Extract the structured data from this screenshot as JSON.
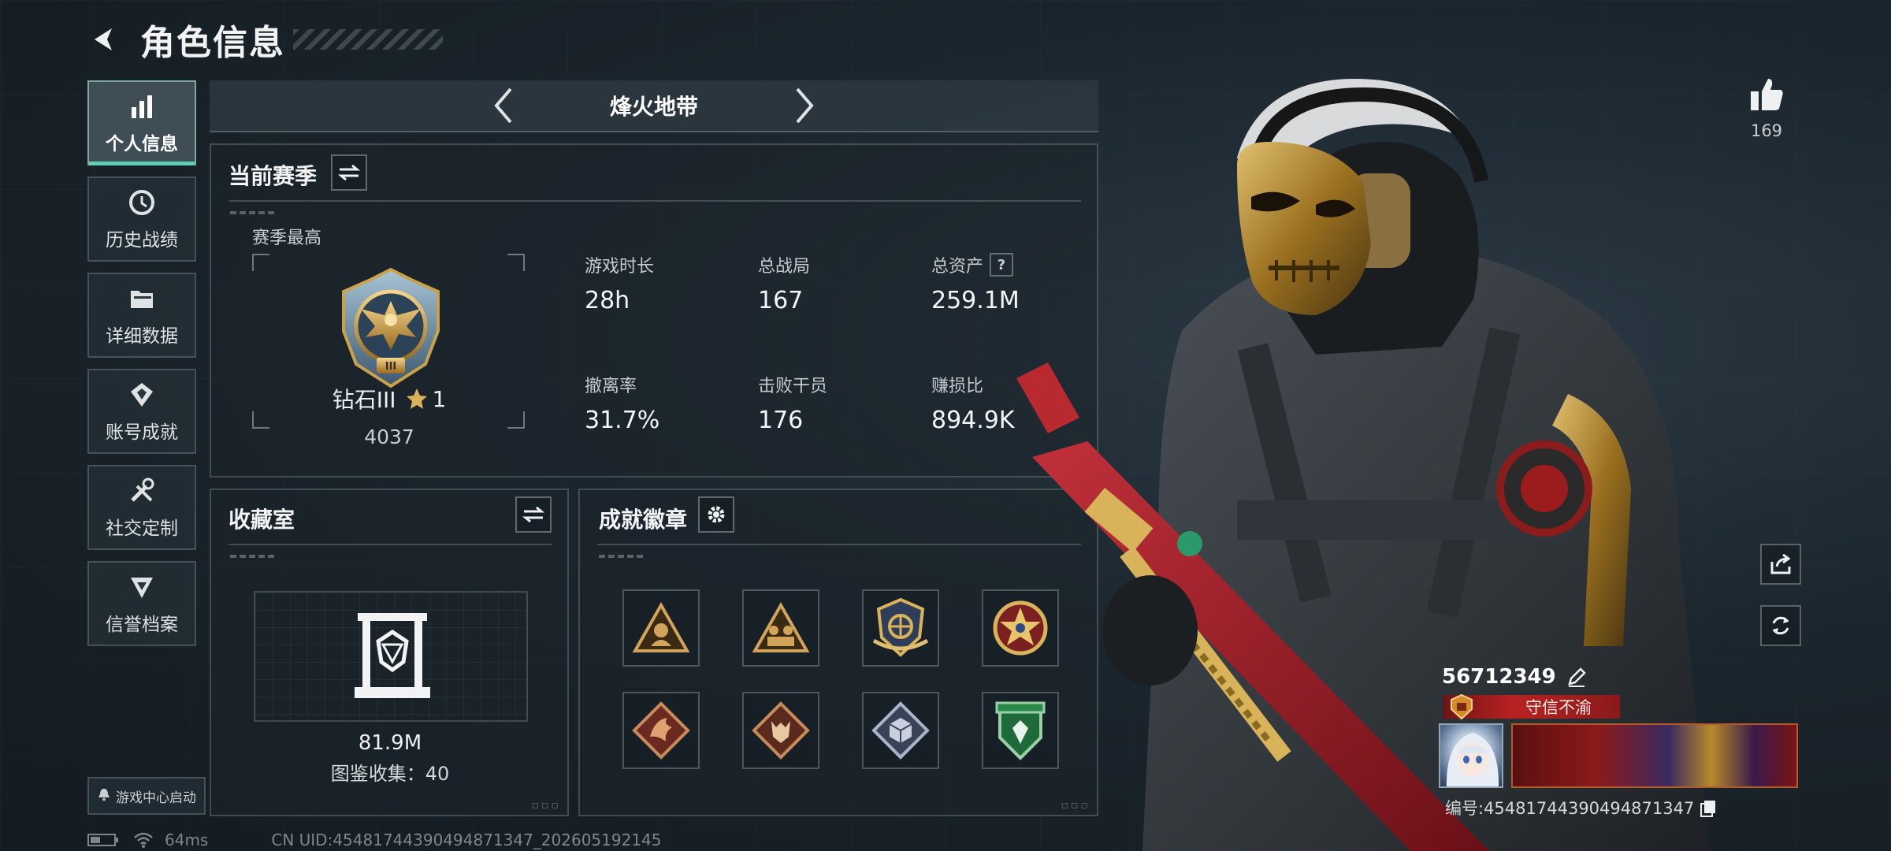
{
  "header": {
    "title": "角色信息"
  },
  "sidebar": {
    "items": [
      {
        "label": "个人信息",
        "icon": "bar-chart-icon",
        "active": true
      },
      {
        "label": "历史战绩",
        "icon": "history-icon"
      },
      {
        "label": "详细数据",
        "icon": "folder-icon"
      },
      {
        "label": "账号成就",
        "icon": "achievement-icon"
      },
      {
        "label": "社交定制",
        "icon": "tools-icon"
      },
      {
        "label": "信誉档案",
        "icon": "credit-icon"
      }
    ],
    "launch_label": "游戏中心启动"
  },
  "mode": {
    "name": "烽火地带"
  },
  "season": {
    "title": "当前赛季",
    "best_label": "赛季最高",
    "rank_name": "钻石III",
    "rank_stars": "1",
    "rank_score": "4037",
    "stats": [
      {
        "label": "游戏时长",
        "value": "28h"
      },
      {
        "label": "总战局",
        "value": "167"
      },
      {
        "label": "总资产",
        "value": "259.1M",
        "help": "?"
      },
      {
        "label": "撤离率",
        "value": "31.7%"
      },
      {
        "label": "击败干员",
        "value": "176"
      },
      {
        "label": "赚损比",
        "value": "894.9K"
      }
    ]
  },
  "collection": {
    "title": "收藏室",
    "value": "81.9M",
    "count_text": "图鉴收集：40"
  },
  "badges": {
    "title": "成就徽章",
    "items": [
      {
        "name": "badge-triangle-portrait"
      },
      {
        "name": "badge-triangle-soldiers"
      },
      {
        "name": "badge-shield-wings"
      },
      {
        "name": "badge-star-round"
      },
      {
        "name": "badge-dragon-diamond"
      },
      {
        "name": "badge-wolf-diamond"
      },
      {
        "name": "badge-cube-diamond"
      },
      {
        "name": "badge-green-shield"
      }
    ]
  },
  "profile": {
    "likes": "169",
    "player_id": "56712349",
    "title_tag": "守信不渝",
    "uid_line": "编号:45481744390494871347"
  },
  "footer": {
    "ping": "64ms",
    "uid": "CN UID:45481744390494871347_202605192145"
  },
  "colors": {
    "accent": "#5fd0b4",
    "tag_red": "#b82222",
    "gold": "#c9a24a"
  }
}
